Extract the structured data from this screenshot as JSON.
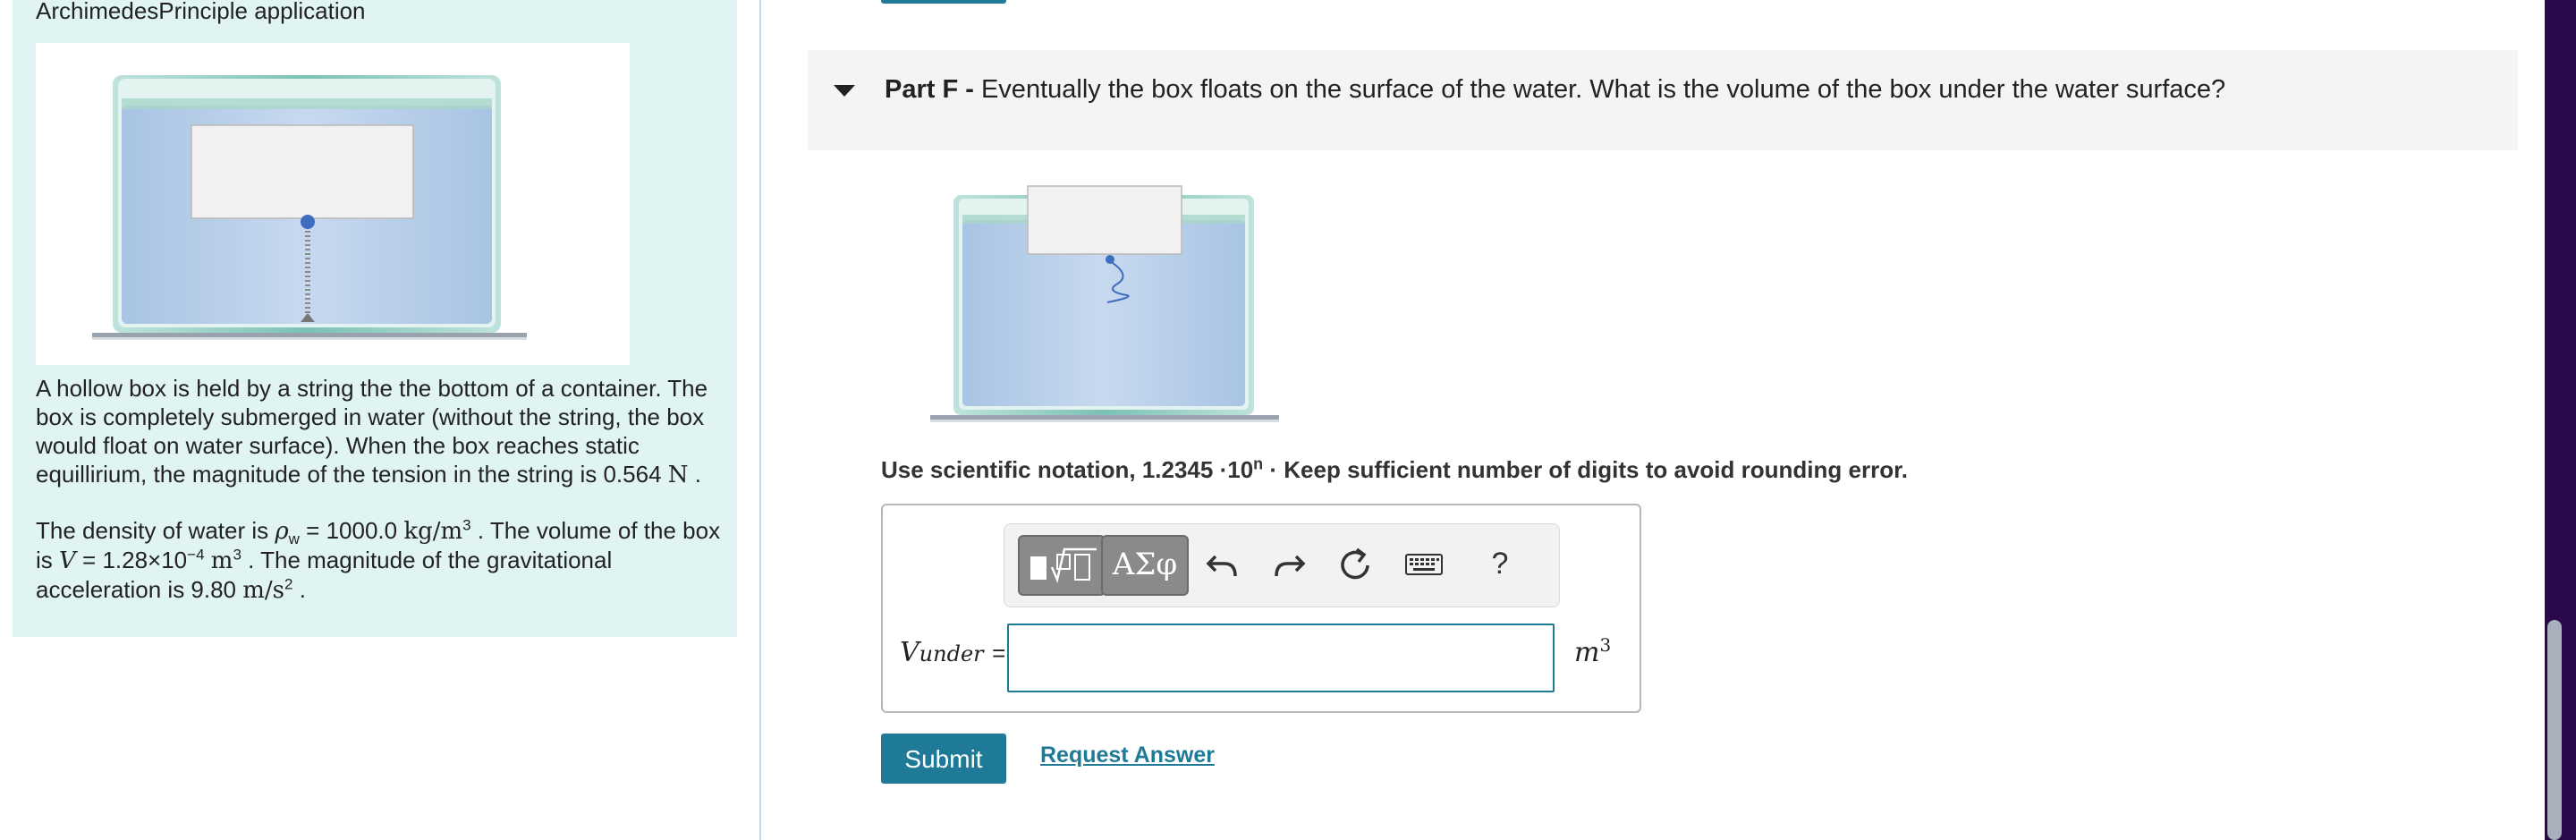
{
  "left": {
    "title": "ArchimedesPrinciple application",
    "paragraph1": {
      "text": "A hollow box is held by a string the the bottom of a container. The box is completely submerged in water (without the string, the box would float on water surface). When the box reaches static equillirium, the magnitude of the tension in the string is 0.564",
      "unit": "N",
      "end": "."
    },
    "paragraph2": {
      "pre": "The density of water is",
      "rho_symbol": "ρ",
      "rho_sub": "w",
      "eq_value": "= 1000.0",
      "rho_unit": "kg/m",
      "rho_unit_exp": "3",
      "mid": ". The volume of the box is",
      "V_symbol": "V",
      "V_value": "= 1.28×10",
      "V_exp": "−4",
      "V_unit": "m",
      "V_unit_exp": "3",
      "post": ". The magnitude of the gravitational acceleration is 9.80",
      "g_unit": "m/s",
      "g_unit_exp": "2",
      "end": "."
    }
  },
  "part": {
    "label": "Part F -",
    "question": "Eventually the box floats on the surface of the water. What is the volume of the box under the water surface?"
  },
  "instructions": {
    "pre": "Use scientific notation, 1.2345 ·10",
    "exp": "n",
    "post": "· Keep sufficient number of digits to avoid rounding error."
  },
  "toolbar": {
    "templates_icon": "sqrt-template-icon",
    "symbols_label": "ΑΣφ",
    "undo_icon": "undo-icon",
    "redo_icon": "redo-icon",
    "reset_icon": "reset-icon",
    "keyboard_icon": "keyboard-icon",
    "help_label": "?"
  },
  "answer": {
    "var": "V",
    "var_sub": "under",
    "eq": "=",
    "value": "",
    "unit": "m",
    "unit_exp": "3"
  },
  "buttons": {
    "submit": "Submit",
    "request": "Request Answer"
  },
  "colors": {
    "accent": "#1e7a96",
    "panel_bg": "#e1f4f4",
    "water": "#b9d0ea"
  }
}
